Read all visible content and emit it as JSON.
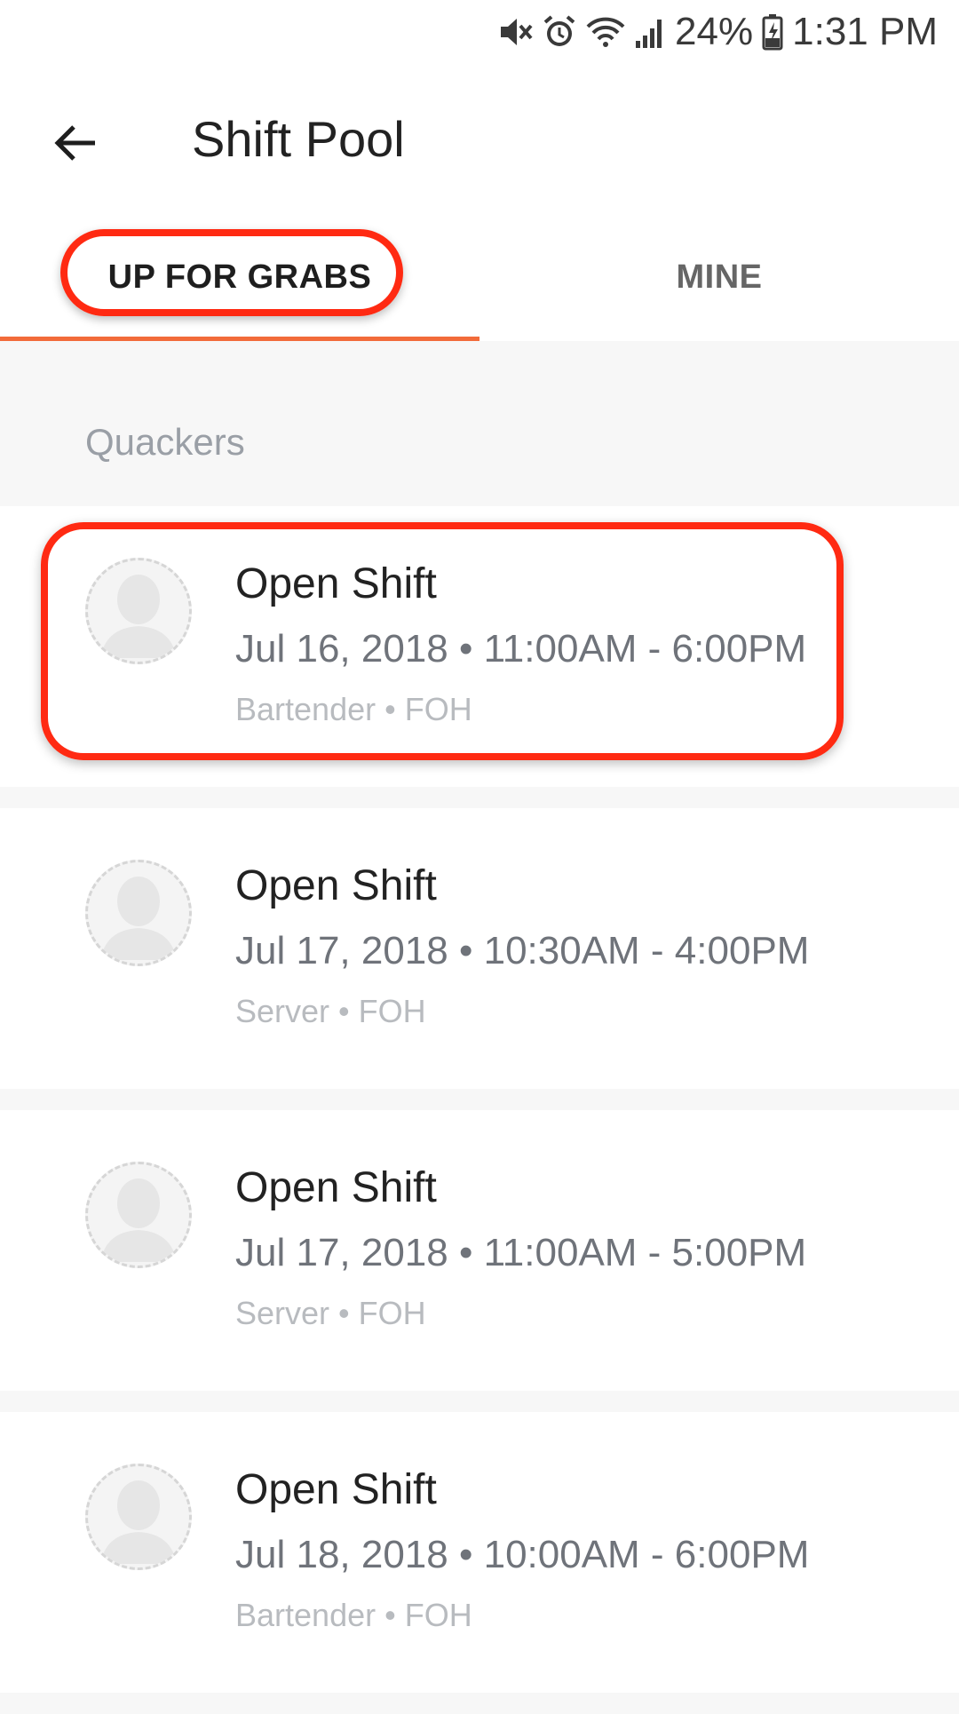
{
  "status_bar": {
    "battery": "24%",
    "time": "1:31 PM",
    "icons": [
      "mute-icon",
      "alarm-icon",
      "wifi-icon",
      "signal-icon",
      "battery-charging-icon"
    ]
  },
  "app_bar": {
    "back_icon": "arrow-left-icon",
    "title": "Shift Pool"
  },
  "tabs": [
    {
      "label": "UP FOR GRABS",
      "active": true
    },
    {
      "label": "MINE",
      "active": false
    }
  ],
  "colors": {
    "accent": "#f26b3a",
    "highlight": "#ff2a12"
  },
  "section": {
    "label": "Quackers"
  },
  "shifts": [
    {
      "title": "Open Shift",
      "time": "Jul 16, 2018 • 11:00AM - 6:00PM",
      "meta": "Bartender • FOH"
    },
    {
      "title": "Open Shift",
      "time": "Jul 17, 2018 • 10:30AM - 4:00PM",
      "meta": "Server • FOH"
    },
    {
      "title": "Open Shift",
      "time": "Jul 17, 2018 • 11:00AM - 5:00PM",
      "meta": "Server • FOH"
    },
    {
      "title": "Open Shift",
      "time": "Jul 18, 2018 • 10:00AM - 6:00PM",
      "meta": "Bartender • FOH"
    }
  ]
}
